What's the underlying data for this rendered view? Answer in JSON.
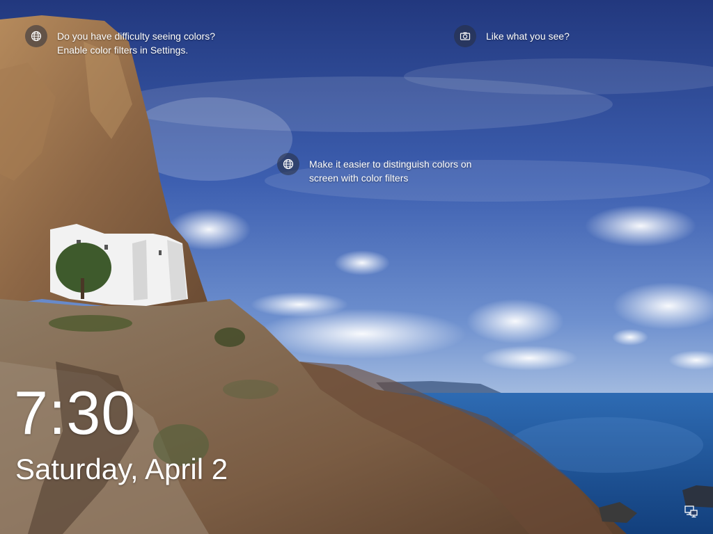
{
  "lock_screen": {
    "tips": [
      {
        "icon": "globe-icon",
        "line1": "Do you have difficulty seeing colors?",
        "line2": "Enable color filters in Settings."
      },
      {
        "icon": "camera-icon",
        "line1": "Like what you see?",
        "line2": ""
      },
      {
        "icon": "globe-icon",
        "line1": "Make it easier to distinguish colors on",
        "line2": "screen with color filters"
      }
    ],
    "time": "7:30",
    "date": "Saturday, April 2",
    "status_icons": [
      "network-icon"
    ]
  },
  "colors": {
    "sky_top": "#27418a",
    "sky_mid": "#4f73c2",
    "sea": "#1f5aa0",
    "cliff": "#9a7350",
    "text": "#ffffff"
  }
}
